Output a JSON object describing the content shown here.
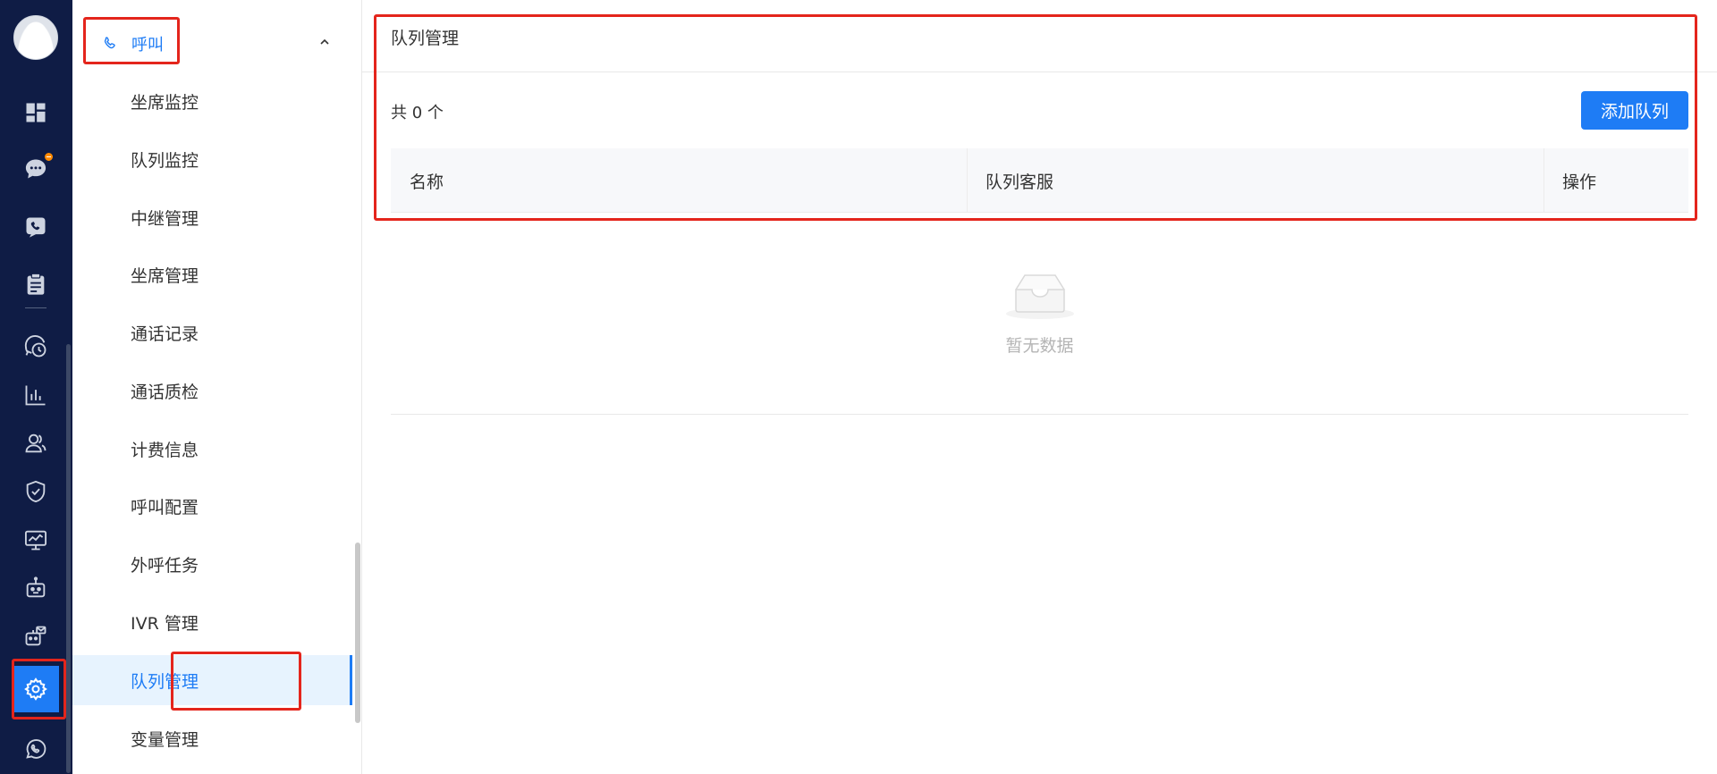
{
  "rail": {
    "items": [
      {
        "name": "dashboard-icon",
        "active": false
      },
      {
        "name": "chat-icon",
        "active": false,
        "badge": true
      },
      {
        "name": "phone-chat-icon",
        "active": false
      },
      {
        "name": "clipboard-icon",
        "active": false
      },
      {
        "name": "history-icon",
        "active": false
      },
      {
        "name": "bar-chart-icon",
        "active": false
      },
      {
        "name": "users-icon",
        "active": false
      },
      {
        "name": "shield-icon",
        "active": false
      },
      {
        "name": "monitor-icon",
        "active": false
      },
      {
        "name": "robot-icon",
        "active": false
      },
      {
        "name": "bot-mail-icon",
        "active": false
      },
      {
        "name": "gear-icon",
        "active": true
      },
      {
        "name": "whatsapp-icon",
        "active": false
      }
    ],
    "colors": {
      "bg": "#0f1c45",
      "active": "#1e7cf5",
      "badge": "#ff8a00"
    }
  },
  "menu": {
    "header": {
      "label": "呼叫",
      "icon": "phone-icon",
      "expanded": true
    },
    "items": [
      {
        "label": "坐席监控",
        "active": false
      },
      {
        "label": "队列监控",
        "active": false
      },
      {
        "label": "中继管理",
        "active": false
      },
      {
        "label": "坐席管理",
        "active": false
      },
      {
        "label": "通话记录",
        "active": false
      },
      {
        "label": "通话质检",
        "active": false
      },
      {
        "label": "计费信息",
        "active": false
      },
      {
        "label": "呼叫配置",
        "active": false
      },
      {
        "label": "外呼任务",
        "active": false
      },
      {
        "label": "IVR 管理",
        "active": false
      },
      {
        "label": "队列管理",
        "active": true
      },
      {
        "label": "变量管理",
        "active": false
      }
    ]
  },
  "main": {
    "title": "队列管理",
    "count_text": "共 0 个",
    "add_button": "添加队列",
    "table": {
      "columns": [
        "名称",
        "队列客服",
        "操作"
      ],
      "rows": [],
      "empty_text": "暂无数据"
    },
    "accent": "#1e7cf5",
    "highlight": "#e4251c"
  }
}
